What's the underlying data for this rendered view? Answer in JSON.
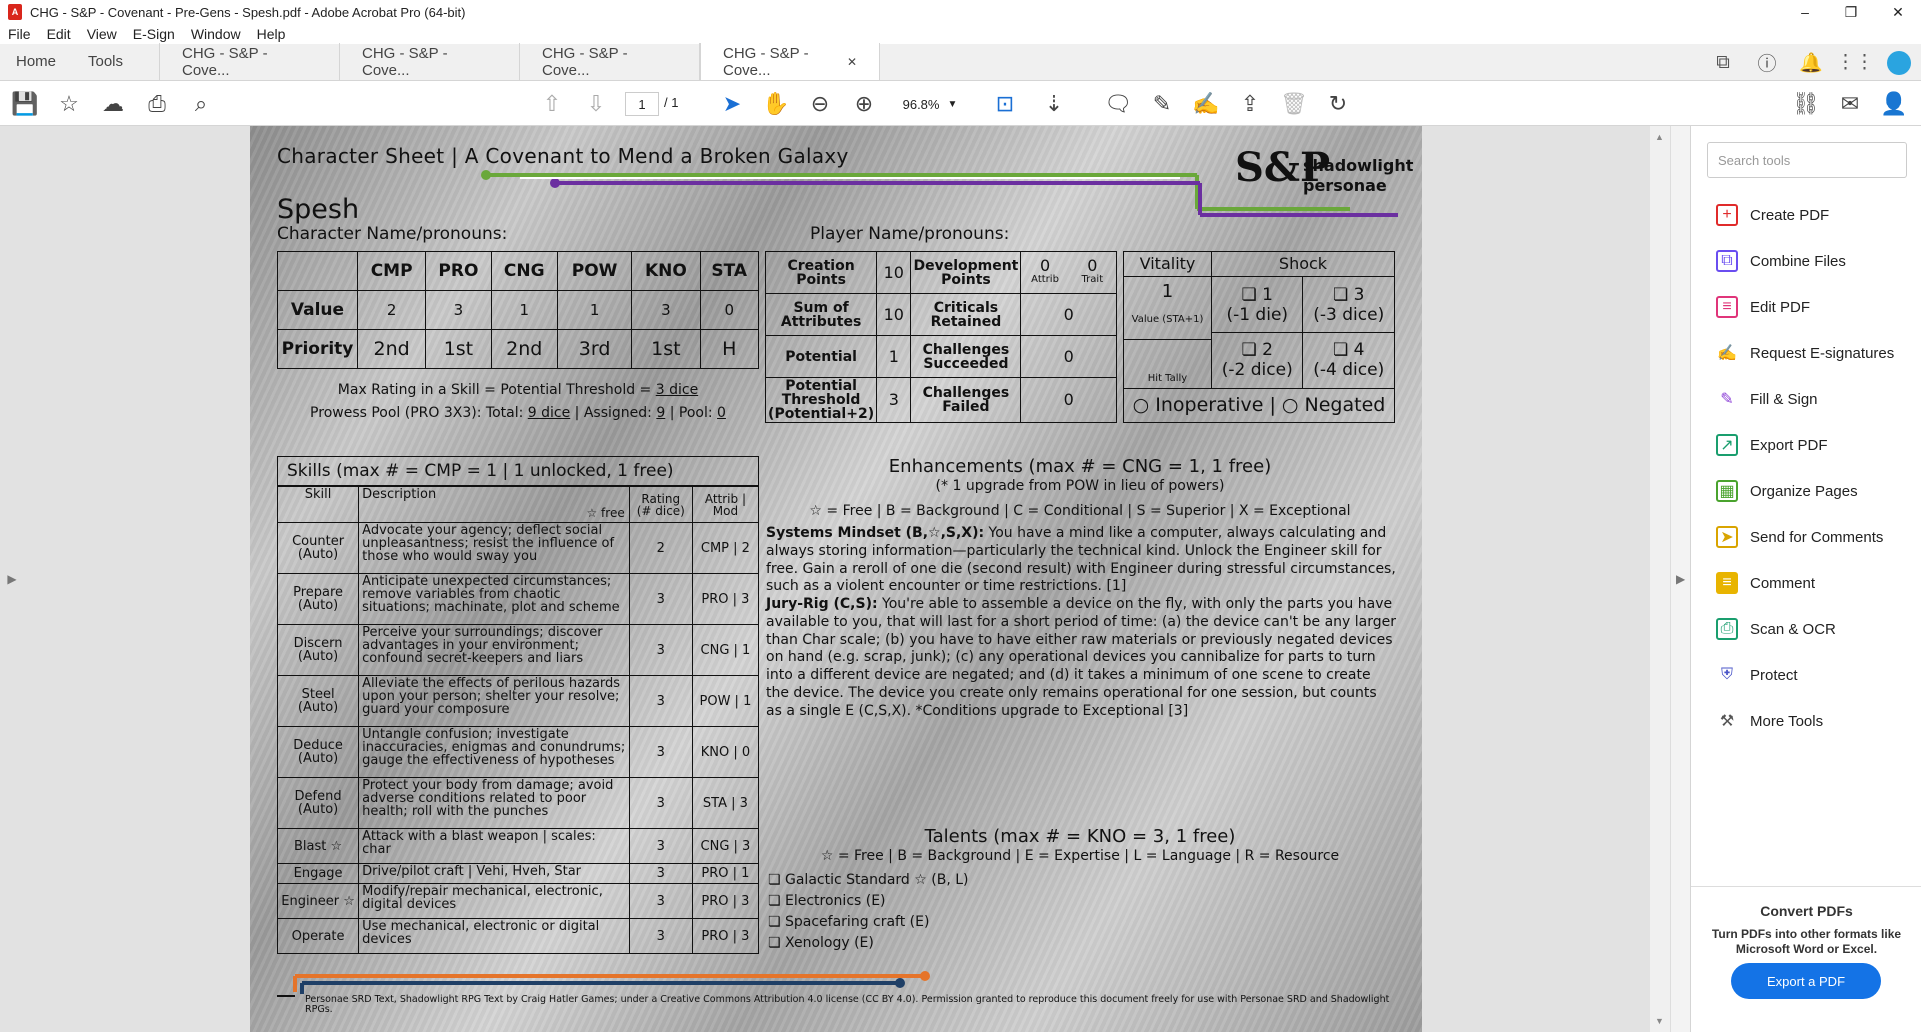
{
  "window": {
    "title": "CHG - S&P - Covenant - Pre-Gens - Spesh.pdf - Adobe Acrobat Pro (64-bit)",
    "minimize": "–",
    "maximize": "❐",
    "close": "✕",
    "app_icon_text": "A"
  },
  "menu": [
    "File",
    "Edit",
    "View",
    "E-Sign",
    "Window",
    "Help"
  ],
  "tabs": {
    "home": "Home",
    "tools": "Tools",
    "docs": [
      "CHG - S&P - Cove...",
      "CHG - S&P - Cove...",
      "CHG - S&P - Cove...",
      "CHG - S&P - Cove..."
    ],
    "close_glyph": "✕"
  },
  "toolbar": {
    "page_current": "1",
    "page_total": "/ 1",
    "zoom": "96.8%"
  },
  "sheet": {
    "header": "Character Sheet | A Covenant to Mend a Broken Galaxy",
    "logo_main": "S&P",
    "logo_sub1": "shadowlight",
    "logo_sub2": "personae",
    "character_name": "Spesh",
    "char_label": "Character Name/pronouns:",
    "player_label": "Player Name/pronouns:",
    "attributes": {
      "headers": [
        "CMP",
        "PRO",
        "CNG",
        "POW",
        "KNO",
        "STA"
      ],
      "value_label": "Value",
      "values": [
        "2",
        "3",
        "1",
        "1",
        "3",
        "0"
      ],
      "priority_label": "Priority",
      "priorities": [
        "2nd",
        "1st",
        "2nd",
        "3rd",
        "1st",
        "H"
      ]
    },
    "max_rating_prefix": "Max Rating in a Skill = Potential Threshold = ",
    "max_rating_value": "3 dice",
    "prowess_prefix": "Prowess Pool (PRO 3X3): Total: ",
    "prowess_total": "9 dice",
    "prowess_assigned_label": " | Assigned: ",
    "prowess_assigned": "9",
    "prowess_pool_label": " | Pool: ",
    "prowess_pool": "0",
    "points": {
      "creation_label": "Creation Points",
      "creation": "10",
      "dev_label": "Development Points",
      "dev_attrib": "0",
      "dev_trait": "0",
      "attrib_label": "Attrib",
      "trait_label": "Trait",
      "sum_label": "Sum of Attributes",
      "sum": "10",
      "crit_label": "Criticals Retained",
      "crit": "0",
      "potential_label": "Potential",
      "potential": "1",
      "succ_label": "Challenges Succeeded",
      "succ": "0",
      "threshold_label": "Potential Threshold (Potential+2)",
      "threshold": "3",
      "failed_label": "Challenges Failed",
      "failed": "0"
    },
    "vitality": {
      "label": "Vitality",
      "shock_label": "Shock",
      "value": "1",
      "sub": "Value (STA+1)",
      "hit_tally": "Hit Tally",
      "box": "❏",
      "shock1": "1",
      "shock1d": "(-1 die)",
      "shock3": "3",
      "shock3d": "(-3 dice)",
      "shock2": "2",
      "shock2d": "(-2 dice)",
      "shock4": "4",
      "shock4d": "(-4 dice)",
      "status": "○ Inoperative | ○ Negated"
    },
    "skills": {
      "title": "Skills (max # = CMP = 1 | 1 unlocked, 1 free)",
      "h_skill": "Skill",
      "h_desc": "Description",
      "h_free": "☆ free",
      "h_rating": "Rating (# dice)",
      "h_attrib": "Attrib | Mod",
      "rows": [
        {
          "name": "Counter (Auto)",
          "desc": "Advocate your agency; deflect social unpleasantness; resist the influence of those who would sway you",
          "rating": "2",
          "attr": "CMP | 2"
        },
        {
          "name": "Prepare (Auto)",
          "desc": "Anticipate unexpected circumstances; remove variables from chaotic situations; machinate, plot and scheme",
          "rating": "3",
          "attr": "PRO | 3"
        },
        {
          "name": "Discern (Auto)",
          "desc": "Perceive your surroundings; discover advantages in your environment; confound secret-keepers and liars",
          "rating": "3",
          "attr": "CNG | 1"
        },
        {
          "name": "Steel (Auto)",
          "desc": "Alleviate the effects of perilous hazards upon your person; shelter your resolve; guard your composure",
          "rating": "3",
          "attr": "POW | 1"
        },
        {
          "name": "Deduce (Auto)",
          "desc": "Untangle confusion; investigate inaccuracies, enigmas and conundrums; gauge the effectiveness of hypotheses",
          "rating": "3",
          "attr": "KNO | 0"
        },
        {
          "name": "Defend (Auto)",
          "desc": "Protect your body from damage; avoid adverse conditions related to poor health; roll with the punches",
          "rating": "3",
          "attr": "STA | 3"
        },
        {
          "name": "Blast ☆",
          "desc": "Attack with a blast weapon | scales: char",
          "rating": "3",
          "attr": "CNG | 3"
        },
        {
          "name": "Engage",
          "desc": "Drive/pilot craft | Vehi, Hveh, Star",
          "rating": "3",
          "attr": "PRO | 1"
        },
        {
          "name": "Engineer ☆",
          "desc": "Modify/repair mechanical, electronic, digital devices",
          "rating": "3",
          "attr": "PRO | 3"
        },
        {
          "name": "Operate",
          "desc": "Use mechanical, electronic or digital devices",
          "rating": "3",
          "attr": "PRO | 3"
        }
      ]
    },
    "enhancements": {
      "title": "Enhancements (max # = CNG = 1, 1 free)",
      "note": "(* 1 upgrade from POW in lieu of powers)",
      "legend": "☆ = Free | B = Background | C = Conditional | S = Superior | X = Exceptional",
      "e1_name": "Systems Mindset (B,☆,S,X):",
      "e1_text": " You have a mind like a computer, always calculating and always storing information—particularly the technical kind. Unlock the Engineer skill for free. Gain a reroll of one die (second result) with Engineer during stressful circumstances, such as a violent encounter or time restrictions. [1]",
      "e2_name": "Jury-Rig (C,S):",
      "e2_text": " You're able to assemble a device on the fly, with only the parts you have available to you, that will last for a short period of time: (a) the device can't be any larger than Char scale; (b) you have to have either raw materials or previously negated devices on hand (e.g. scrap, junk); (c) any operational devices you cannibalize for parts to turn into a different device are negated; and (d) it takes a minimum of one scene to create the device. The device you create only remains operational for one session, but counts as a single E (C,S,X). *Conditions upgrade to Exceptional [3]"
    },
    "talents": {
      "title": "Talents (max # = KNO = 3, 1 free)",
      "legend": "☆ = Free | B = Background | E = Expertise | L = Language | R = Resource",
      "items": [
        "❏ Galactic Standard ☆ (B, L)",
        "❏ Electronics (E)",
        "❏ Spacefaring craft (E)",
        "❏ Xenology (E)"
      ]
    },
    "footer": "Personae SRD Text, Shadowlight RPG Text by Craig Hatler Games; under a Creative Commons Attribution 4.0 license (CC BY 4.0). Permission granted to reproduce this document freely for use with Personae SRD and Shadowlight RPGs."
  },
  "panel": {
    "search_placeholder": "Search tools",
    "tools": [
      "Create PDF",
      "Combine Files",
      "Edit PDF",
      "Request E-signatures",
      "Fill & Sign",
      "Export PDF",
      "Organize Pages",
      "Send for Comments",
      "Comment",
      "Scan & OCR",
      "Protect",
      "More Tools"
    ],
    "convert_title": "Convert PDFs",
    "convert_text": "Turn PDFs into other formats like Microsoft Word or Excel.",
    "export_button": "Export a PDF"
  },
  "colors": {
    "accent_blue": "#1473e6",
    "line_green": "#6aa83a",
    "line_purple": "#6b2fa0",
    "line_orange": "#e5742a",
    "line_navy": "#1f3f66"
  }
}
